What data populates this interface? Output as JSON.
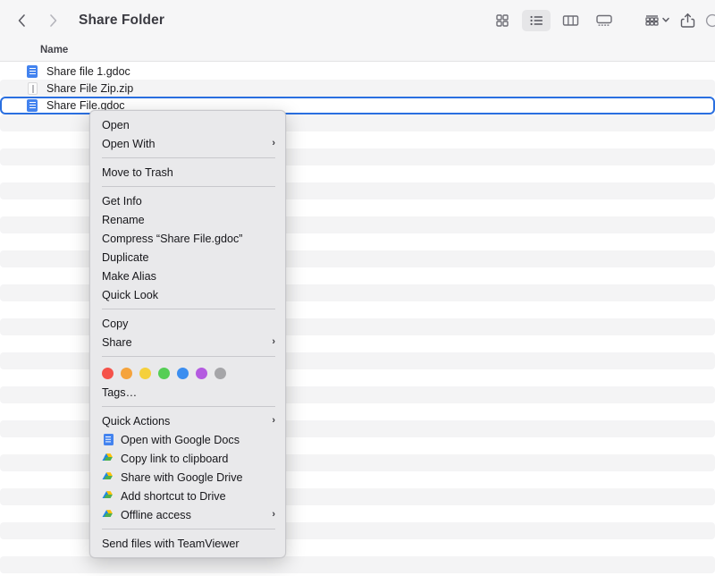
{
  "toolbar": {
    "back_label": "Back",
    "forward_label": "Forward",
    "title": "Share Folder",
    "view_buttons": [
      {
        "name": "icon-view",
        "label": "Icon View",
        "active": false
      },
      {
        "name": "list-view",
        "label": "List View",
        "active": true
      },
      {
        "name": "column-view",
        "label": "Column View",
        "active": false
      },
      {
        "name": "gallery-view",
        "label": "Gallery View",
        "active": false
      }
    ],
    "group_label": "Group",
    "share_label": "Share",
    "more_label": "More"
  },
  "columns": {
    "name": "Name"
  },
  "files": [
    {
      "name": "Share file 1.gdoc",
      "icon": "gdoc-icon",
      "selected": false
    },
    {
      "name": "Share File Zip.zip",
      "icon": "zip-icon",
      "selected": false
    },
    {
      "name": "Share File.gdoc",
      "icon": "gdoc-icon",
      "selected": true
    }
  ],
  "context_menu": {
    "items": [
      {
        "label": "Open",
        "submenu": false,
        "icon": null
      },
      {
        "label": "Open With",
        "submenu": true,
        "icon": null
      },
      {
        "separator": true
      },
      {
        "label": "Move to Trash",
        "submenu": false,
        "icon": null
      },
      {
        "separator": true
      },
      {
        "label": "Get Info",
        "submenu": false,
        "icon": null
      },
      {
        "label": "Rename",
        "submenu": false,
        "icon": null
      },
      {
        "label": "Compress “Share File.gdoc”",
        "submenu": false,
        "icon": null
      },
      {
        "label": "Duplicate",
        "submenu": false,
        "icon": null
      },
      {
        "label": "Make Alias",
        "submenu": false,
        "icon": null
      },
      {
        "label": "Quick Look",
        "submenu": false,
        "icon": null
      },
      {
        "separator": true
      },
      {
        "label": "Copy",
        "submenu": false,
        "icon": null
      },
      {
        "label": "Share",
        "submenu": true,
        "icon": null
      },
      {
        "separator": true
      },
      {
        "tags": true
      },
      {
        "label": "Tags…",
        "submenu": false,
        "icon": null
      },
      {
        "separator": true
      },
      {
        "label": "Quick Actions",
        "submenu": true,
        "icon": null
      },
      {
        "label": "Open with Google Docs",
        "submenu": false,
        "icon": "google-docs-icon"
      },
      {
        "label": "Copy link to clipboard",
        "submenu": false,
        "icon": "google-drive-icon"
      },
      {
        "label": "Share with Google Drive",
        "submenu": false,
        "icon": "google-drive-icon"
      },
      {
        "label": "Add shortcut to Drive",
        "submenu": false,
        "icon": "google-drive-icon"
      },
      {
        "label": "Offline access",
        "submenu": true,
        "icon": "google-drive-icon"
      },
      {
        "separator": true
      },
      {
        "label": "Send files with TeamViewer",
        "submenu": false,
        "icon": null
      }
    ],
    "submenu_arrow": "›",
    "tag_colors": [
      {
        "name": "red",
        "hex": "#F5524A"
      },
      {
        "name": "orange",
        "hex": "#F5A33C"
      },
      {
        "name": "yellow",
        "hex": "#F5D03C"
      },
      {
        "name": "green",
        "hex": "#55CE55"
      },
      {
        "name": "blue",
        "hex": "#3C8EF0"
      },
      {
        "name": "purple",
        "hex": "#B45BE0"
      },
      {
        "name": "gray",
        "hex": "#A5A5A8"
      }
    ]
  },
  "colors": {
    "selection_border": "#2a6fe0",
    "toolbar_bg": "#f6f6f7",
    "menu_bg": "#e9e9eb",
    "row_alt": "#f4f4f5",
    "doc_blue": "#4383ef"
  }
}
